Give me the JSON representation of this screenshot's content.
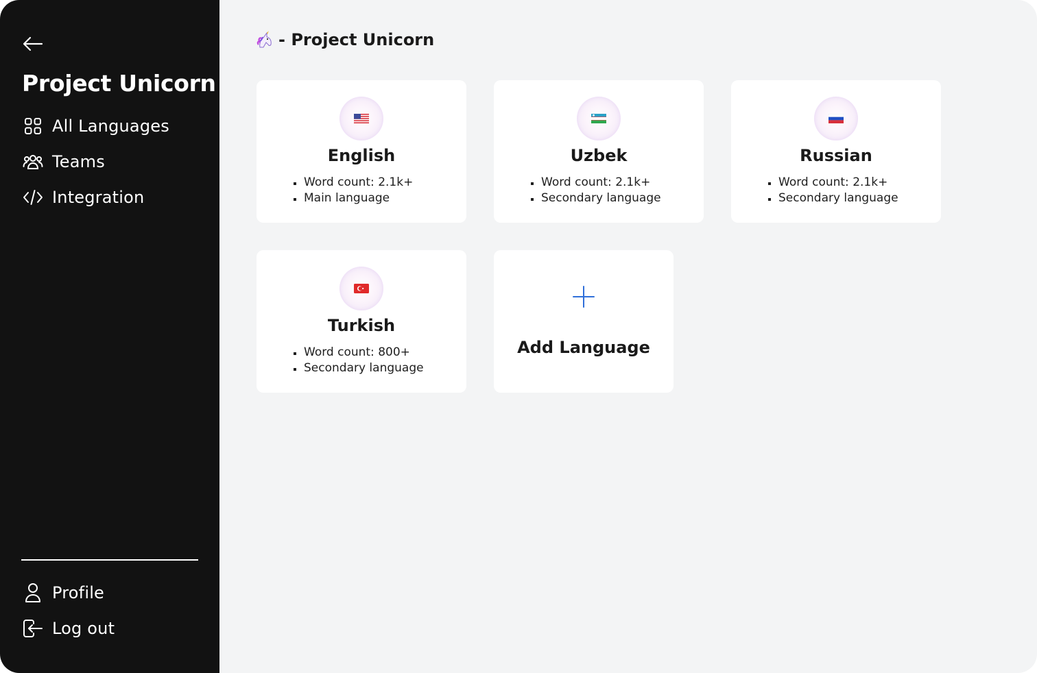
{
  "sidebar": {
    "title": "Project Unicorn",
    "nav": [
      {
        "label": "All Languages",
        "icon": "grid-icon"
      },
      {
        "label": "Teams",
        "icon": "users-icon"
      },
      {
        "label": "Integration",
        "icon": "code-icon"
      }
    ],
    "bottom_nav": [
      {
        "label": "Profile",
        "icon": "user-icon"
      },
      {
        "label": "Log out",
        "icon": "logout-icon"
      }
    ]
  },
  "main": {
    "title": "- Project Unicorn",
    "title_icon": "unicorn-icon",
    "languages": [
      {
        "name": "English",
        "flag": "us-flag-icon",
        "details": [
          "Word count: 2.1k+",
          "Main language"
        ]
      },
      {
        "name": "Uzbek",
        "flag": "uz-flag-icon",
        "details": [
          "Word count: 2.1k+",
          "Secondary language"
        ]
      },
      {
        "name": "Russian",
        "flag": "ru-flag-icon",
        "details": [
          "Word count: 2.1k+",
          "Secondary language"
        ]
      },
      {
        "name": "Turkish",
        "flag": "tr-flag-icon",
        "details": [
          "Word count: 800+",
          "Secondary language"
        ]
      }
    ],
    "add_language_label": "Add Language"
  },
  "colors": {
    "sidebar_bg": "#121212",
    "main_bg": "#f3f4f5",
    "card_bg": "#ffffff",
    "accent_plus": "#2f6fd9"
  }
}
